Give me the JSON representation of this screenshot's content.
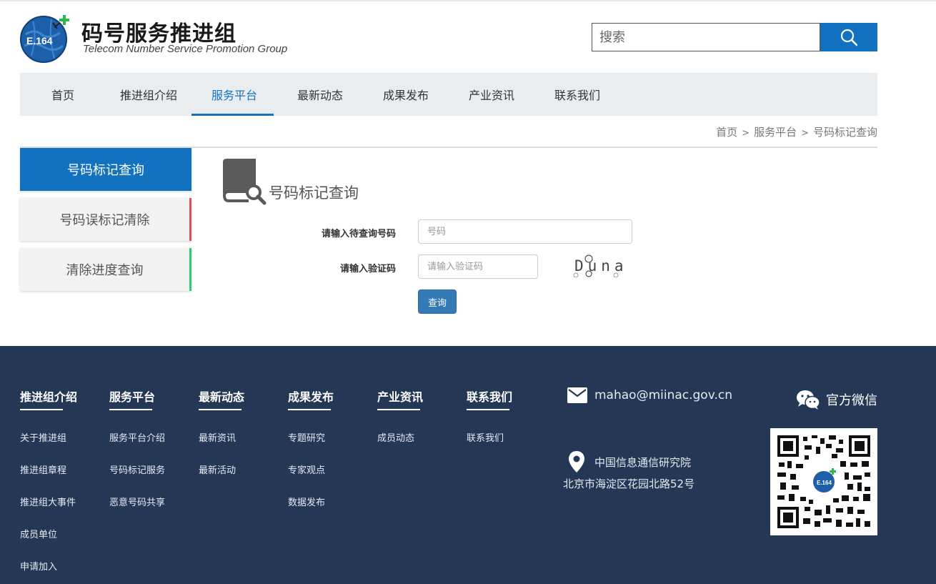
{
  "header": {
    "logo_badge": "E.164",
    "title": "码号服务推进组",
    "subtitle": "Telecom Number Service  Promotion Group",
    "search_placeholder": "搜索"
  },
  "nav": {
    "items": [
      {
        "label": "首页",
        "active": false
      },
      {
        "label": "推进组介绍",
        "active": false
      },
      {
        "label": "服务平台",
        "active": true
      },
      {
        "label": "最新动态",
        "active": false
      },
      {
        "label": "成果发布",
        "active": false
      },
      {
        "label": "产业资讯",
        "active": false
      },
      {
        "label": "联系我们",
        "active": false
      }
    ]
  },
  "breadcrumb": {
    "home": "首页",
    "section": "服务平台",
    "current": "号码标记查询",
    "separator": ">"
  },
  "sidebar": {
    "items": [
      {
        "label": "号码标记查询",
        "active": true
      },
      {
        "label": "号码误标记清除",
        "accent": "#e84c5f"
      },
      {
        "label": "清除进度查询",
        "accent": "#2ecc71"
      }
    ]
  },
  "main": {
    "title": "号码标记查询",
    "number_label": "请输入待查询号码",
    "number_placeholder": "号码",
    "captcha_label": "请输入验证码",
    "captcha_placeholder": "请输入验证码",
    "captcha_text": "Duna",
    "query_button": "查询"
  },
  "footer": {
    "columns": [
      {
        "title": "推进组介绍",
        "links": [
          "关于推进组",
          "推进组章程",
          "推进组大事件",
          "成员单位",
          "申请加入"
        ]
      },
      {
        "title": "服务平台",
        "links": [
          "服务平台介绍",
          "号码标记服务",
          "恶意号码共享"
        ]
      },
      {
        "title": "最新动态",
        "links": [
          "最新资讯",
          "最新活动"
        ]
      },
      {
        "title": "成果发布",
        "links": [
          "专题研究",
          "专家观点",
          "数据发布"
        ]
      },
      {
        "title": "产业资讯",
        "links": [
          "成员动态"
        ]
      },
      {
        "title": "联系我们",
        "links": [
          "联系我们"
        ]
      }
    ],
    "email": "mahao@miinac.gov.cn",
    "org": "中国信息通信研究院",
    "address": "北京市海淀区花园北路52号",
    "wechat_label": "官方微信",
    "qr_badge": "E.164"
  },
  "colors": {
    "brand_blue": "#1272c0",
    "footer_bg": "#243856",
    "nav_bg": "#eaedf0"
  }
}
